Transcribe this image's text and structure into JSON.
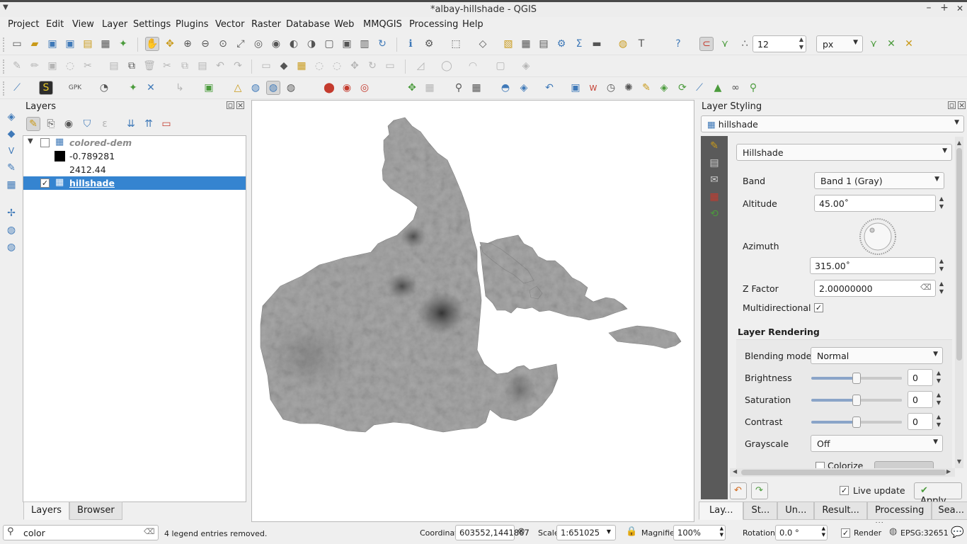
{
  "window": {
    "title": "*albay-hillshade - QGIS",
    "minimize": "–",
    "maximize": "+",
    "close": "✕"
  },
  "menu": [
    "Project",
    "Edit",
    "View",
    "Layer",
    "Settings",
    "Plugins",
    "Vector",
    "Raster",
    "Database",
    "Web",
    "MMQGIS",
    "Processing",
    "Help"
  ],
  "snapping": {
    "tolerance": "12",
    "unit": "px"
  },
  "layers_panel": {
    "title": "Layers",
    "layers": [
      {
        "name": "colored-dem",
        "checked": false,
        "expanded": true,
        "legend": [
          {
            "label": "-0.789281",
            "color": "#000000"
          },
          {
            "label": "2412.44"
          }
        ]
      },
      {
        "name": "hillshade",
        "checked": true,
        "selected": true
      }
    ],
    "tabs": [
      "Layers",
      "Browser"
    ]
  },
  "styling_panel": {
    "title": "Layer Styling",
    "layer": "hillshade",
    "renderer": "Hillshade",
    "band_label": "Band",
    "band": "Band 1 (Gray)",
    "altitude_label": "Altitude",
    "altitude": "45.00˚",
    "azimuth_label": "Azimuth",
    "azimuth": "315.00˚",
    "zfactor_label": "Z Factor",
    "zfactor": "2.00000000",
    "multidirectional_label": "Multidirectional",
    "multidirectional": true,
    "rendering_title": "Layer Rendering",
    "blending_label": "Blending mode",
    "blending": "Normal",
    "brightness_label": "Brightness",
    "brightness": "0",
    "saturation_label": "Saturation",
    "saturation": "0",
    "contrast_label": "Contrast",
    "contrast": "0",
    "grayscale_label": "Grayscale",
    "grayscale": "Off",
    "colorize_label": "Colorize",
    "live_update_label": "Live update",
    "live_update": true,
    "apply_label": "Apply"
  },
  "bottom_tabs": [
    "Lay...",
    "St...",
    "Un...",
    "Result...",
    "Processing ...",
    "Sea..."
  ],
  "status": {
    "search_value": "color",
    "message": "4 legend entries removed.",
    "coordinate_label": "Coordinate",
    "coordinate": "603552,1441867",
    "scale_label": "Scale",
    "scale": "1:651025",
    "magnifier_label": "Magnifier",
    "magnifier": "100%",
    "rotation_label": "Rotation",
    "rotation": "0.0 °",
    "render_label": "Render",
    "crs": "EPSG:32651"
  },
  "colors": {
    "selection": "#3584d0",
    "accent": "#3f79b8"
  },
  "icons": {
    "search": "search-icon",
    "clear": "clear-icon",
    "messages": "messages-icon"
  }
}
